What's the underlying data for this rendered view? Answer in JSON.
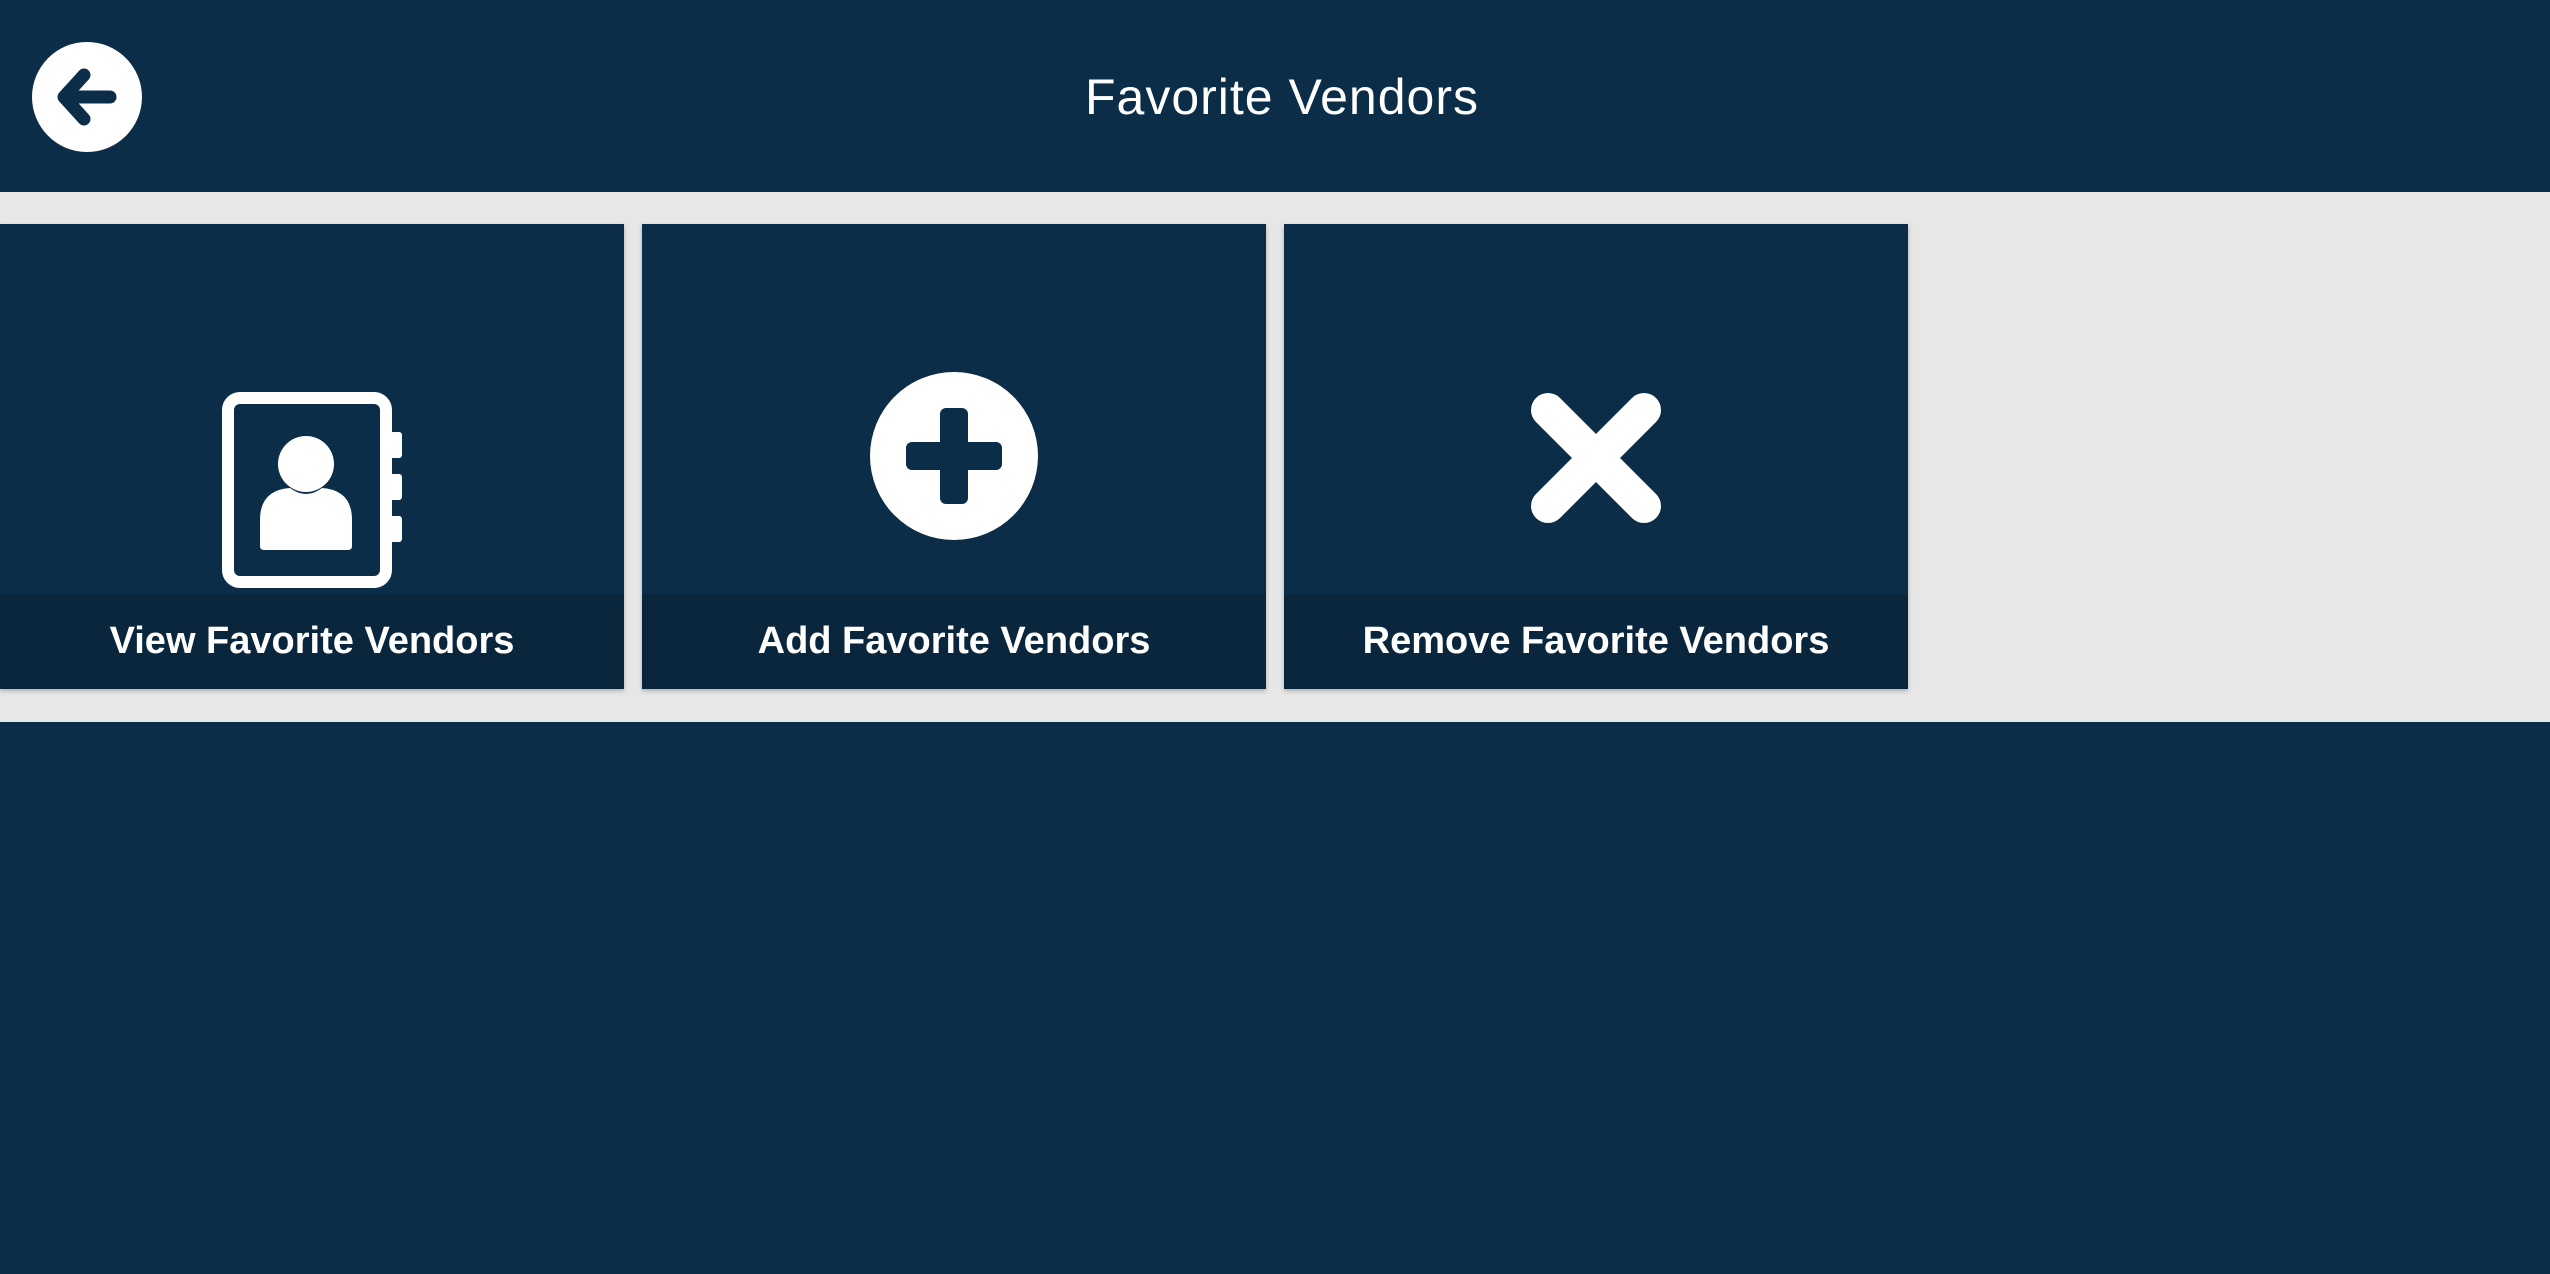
{
  "header": {
    "title": "Favorite Vendors",
    "back_icon": "arrow-left-circle-icon"
  },
  "tiles": [
    {
      "label": "View Favorite Vendors",
      "icon": "contact-book-icon"
    },
    {
      "label": "Add Favorite Vendors",
      "icon": "plus-circle-icon"
    },
    {
      "label": "Remove Favorite Vendors",
      "icon": "x-icon"
    }
  ],
  "colors": {
    "primary": "#0c2d48",
    "tile_footer": "#0a263d",
    "band_background": "#e7e7e7",
    "icon": "#ffffff"
  }
}
